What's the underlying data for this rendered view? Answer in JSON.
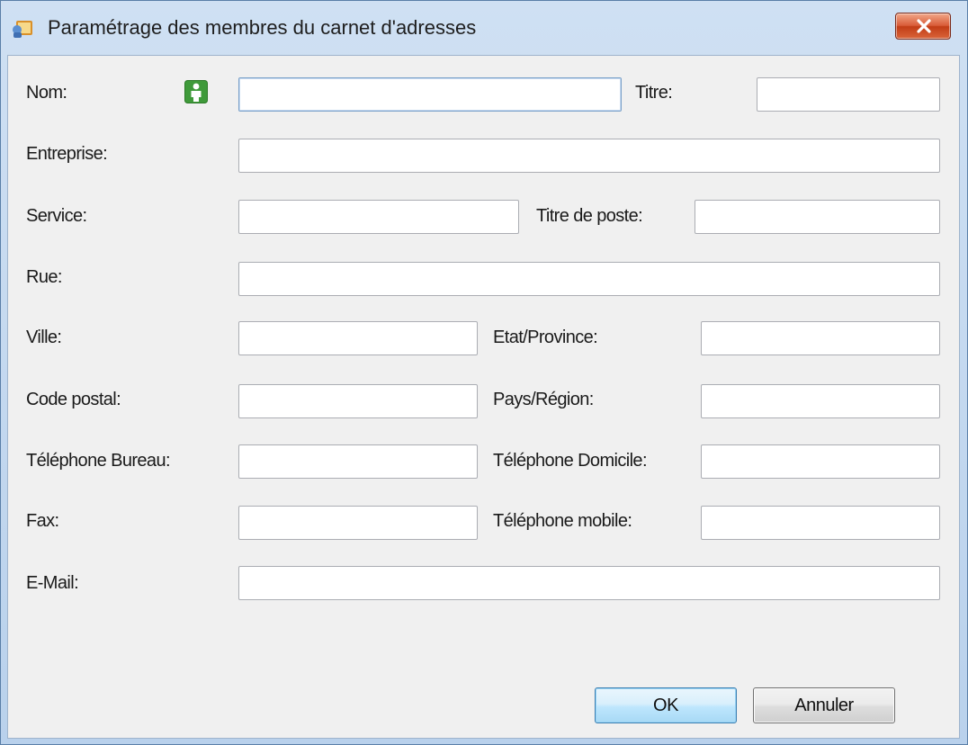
{
  "window": {
    "title": "Paramétrage des membres du carnet d'adresses"
  },
  "form": {
    "nom_label": "Nom:",
    "titre_label": "Titre:",
    "entreprise_label": "Entreprise:",
    "service_label": "Service:",
    "titre_poste_label": "Titre de poste:",
    "rue_label": "Rue:",
    "ville_label": "Ville:",
    "etat_label": "Etat/Province:",
    "code_postal_label": "Code postal:",
    "pays_label": "Pays/Région:",
    "tel_bureau_label": "Téléphone Bureau:",
    "tel_domicile_label": "Téléphone Domicile:",
    "fax_label": "Fax:",
    "tel_mobile_label": "Téléphone mobile:",
    "email_label": "E-Mail:"
  },
  "values": {
    "nom": "",
    "titre": "",
    "entreprise": "",
    "service": "",
    "titre_poste": "",
    "rue": "",
    "ville": "",
    "etat": "",
    "code_postal": "",
    "pays": "",
    "tel_bureau": "",
    "tel_domicile": "",
    "fax": "",
    "tel_mobile": "",
    "email": ""
  },
  "buttons": {
    "ok": "OK",
    "cancel": "Annuler"
  },
  "icons": {
    "window": "address-book-icon",
    "contact": "person-icon",
    "close": "close-icon"
  }
}
